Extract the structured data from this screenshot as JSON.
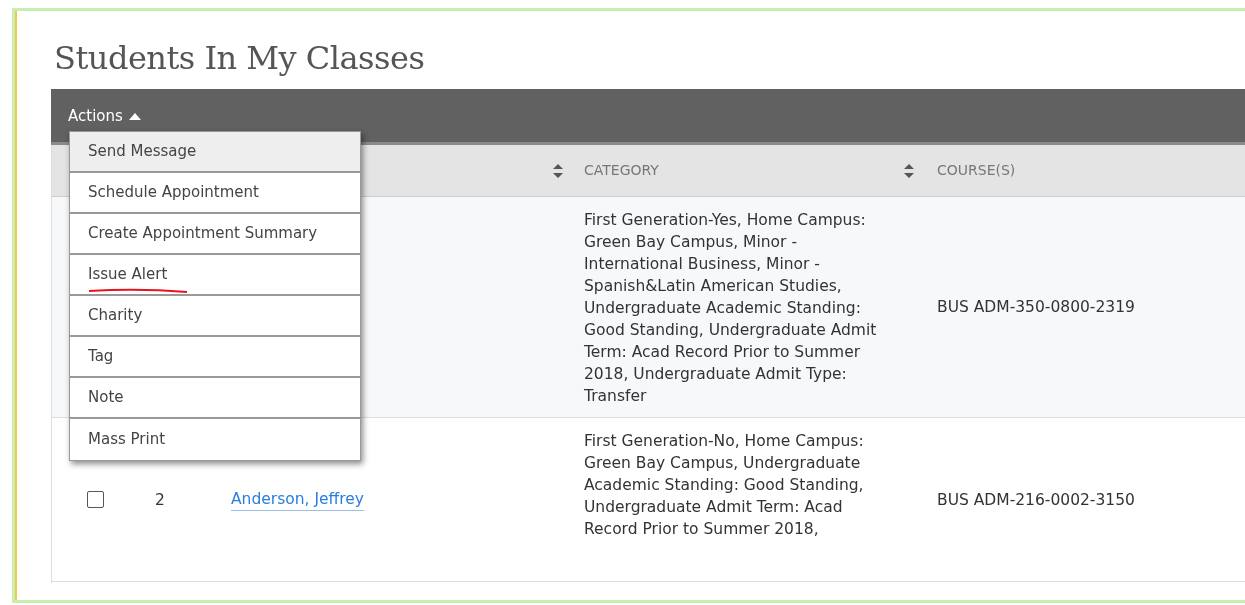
{
  "page": {
    "title": "Students In My Classes"
  },
  "toolbar": {
    "actions_label": "Actions",
    "expanded": true
  },
  "actions_menu": [
    {
      "label": "Send Message",
      "selected": true,
      "annotated": false
    },
    {
      "label": "Schedule Appointment",
      "selected": false,
      "annotated": false
    },
    {
      "label": "Create Appointment Summary",
      "selected": false,
      "annotated": false
    },
    {
      "label": "Issue Alert",
      "selected": false,
      "annotated": true
    },
    {
      "label": "Charity",
      "selected": false,
      "annotated": false
    },
    {
      "label": "Tag",
      "selected": false,
      "annotated": false
    },
    {
      "label": "Note",
      "selected": false,
      "annotated": false
    },
    {
      "label": "Mass Print",
      "selected": false,
      "annotated": false
    }
  ],
  "table": {
    "columns": [
      {
        "label": "CATEGORY"
      },
      {
        "label": "COURSE(S)"
      }
    ],
    "rows": [
      {
        "category": "First Generation-Yes, Home Campus: Green Bay Campus, Minor - International Business, Minor - Spanish&Latin American Studies, Undergraduate Academic Standing: Good Standing, Undergraduate Admit Term: Acad Record Prior to Summer 2018, Undergraduate Admit Type: Transfer",
        "courses": "BUS ADM-350-0800-2319"
      },
      {
        "checked": false,
        "number": "2",
        "name": "Anderson, Jeffrey",
        "category": "First Generation-No, Home Campus: Green Bay Campus, Undergraduate Academic Standing: Good Standing, Undergraduate Admit Term: Acad Record Prior to Summer 2018,",
        "courses": "BUS ADM-216-0002-3150"
      }
    ]
  }
}
